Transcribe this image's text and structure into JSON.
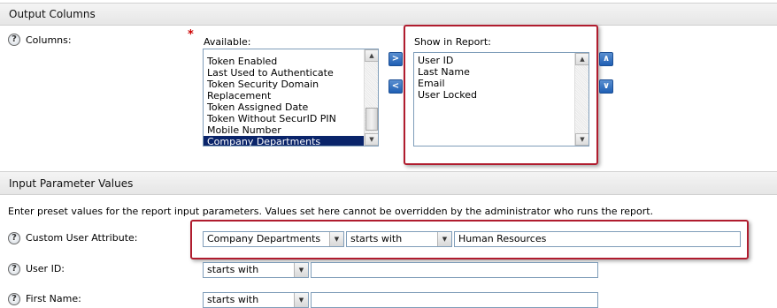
{
  "colors": {
    "highlight_border": "#b01c2e",
    "selected_item_bg": "#0a246a",
    "move_button_blue": "#1f5fb4"
  },
  "output_columns": {
    "section_title": "Output Columns",
    "columns_label": "Columns:",
    "required_mark": "*",
    "available_label": "Available:",
    "available_items": [
      "Token Enabled",
      "Last Used to Authenticate",
      "Token Security Domain",
      "Replacement",
      "Token Assigned Date",
      "Token Without SecurID PIN",
      "Mobile Number",
      "Company Departments"
    ],
    "selected_available": "Company Departments",
    "show_label": "Show in Report:",
    "show_items": [
      "User ID",
      "Last Name",
      "Email",
      "User Locked"
    ],
    "move_right_icon": "chevron-right-icon",
    "move_left_icon": "chevron-left-icon",
    "move_up_icon": "chevron-up-icon",
    "move_down_icon": "chevron-down-icon"
  },
  "input_parameters": {
    "section_title": "Input Parameter Values",
    "description": "Enter preset values for the report input parameters. Values set here cannot be overridden by the administrator who runs the report.",
    "custom_attr_label": "Custom User Attribute:",
    "custom_attr_select": "Company Departments",
    "custom_attr_operator": "starts with",
    "custom_attr_value": "Human Resources",
    "user_id_label": "User ID:",
    "user_id_operator": "starts with",
    "user_id_value": "",
    "first_name_label": "First Name:",
    "first_name_operator": "starts with",
    "first_name_value": ""
  }
}
